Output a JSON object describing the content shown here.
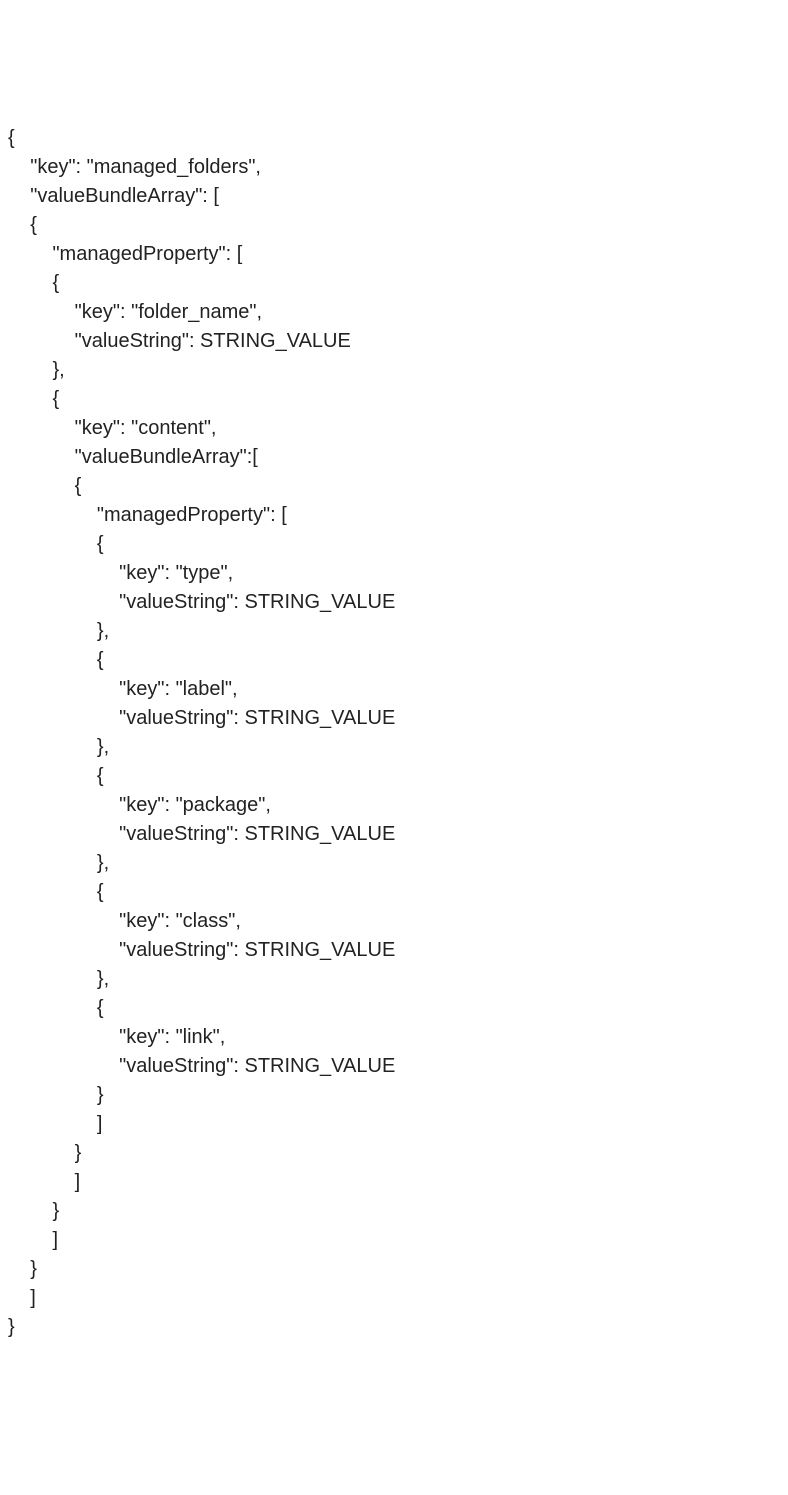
{
  "lines": [
    {
      "indent": 0,
      "text": "{"
    },
    {
      "indent": 1,
      "text": "\"key\": \"managed_folders\","
    },
    {
      "indent": 1,
      "text": "\"valueBundleArray\": ["
    },
    {
      "indent": 1,
      "text": "{"
    },
    {
      "indent": 2,
      "text": "\"managedProperty\": ["
    },
    {
      "indent": 2,
      "text": "{"
    },
    {
      "indent": 3,
      "text": "\"key\": \"folder_name\","
    },
    {
      "indent": 3,
      "text": "\"valueString\": STRING_VALUE"
    },
    {
      "indent": 2,
      "text": "},"
    },
    {
      "indent": 2,
      "text": "{"
    },
    {
      "indent": 3,
      "text": "\"key\": \"content\","
    },
    {
      "indent": 3,
      "text": "\"valueBundleArray\":["
    },
    {
      "indent": 3,
      "text": "{"
    },
    {
      "indent": 4,
      "text": "\"managedProperty\": ["
    },
    {
      "indent": 4,
      "text": "{"
    },
    {
      "indent": 5,
      "text": "\"key\": \"type\","
    },
    {
      "indent": 5,
      "text": "\"valueString\": STRING_VALUE"
    },
    {
      "indent": 4,
      "text": "},"
    },
    {
      "indent": 4,
      "text": "{"
    },
    {
      "indent": 5,
      "text": "\"key\": \"label\","
    },
    {
      "indent": 5,
      "text": "\"valueString\": STRING_VALUE"
    },
    {
      "indent": 4,
      "text": "},"
    },
    {
      "indent": 4,
      "text": "{"
    },
    {
      "indent": 5,
      "text": "\"key\": \"package\","
    },
    {
      "indent": 5,
      "text": "\"valueString\": STRING_VALUE"
    },
    {
      "indent": 4,
      "text": "},"
    },
    {
      "indent": 4,
      "text": "{"
    },
    {
      "indent": 5,
      "text": "\"key\": \"class\","
    },
    {
      "indent": 5,
      "text": "\"valueString\": STRING_VALUE"
    },
    {
      "indent": 4,
      "text": "},"
    },
    {
      "indent": 4,
      "text": "{"
    },
    {
      "indent": 5,
      "text": "\"key\": \"link\","
    },
    {
      "indent": 5,
      "text": "\"valueString\": STRING_VALUE"
    },
    {
      "indent": 4,
      "text": "}"
    },
    {
      "indent": 4,
      "text": "]"
    },
    {
      "indent": 3,
      "text": "}"
    },
    {
      "indent": 3,
      "text": "]"
    },
    {
      "indent": 2,
      "text": "}"
    },
    {
      "indent": 2,
      "text": "]"
    },
    {
      "indent": 1,
      "text": "}"
    },
    {
      "indent": 1,
      "text": "]"
    },
    {
      "indent": 0,
      "text": "}"
    }
  ],
  "indentUnit": "    "
}
